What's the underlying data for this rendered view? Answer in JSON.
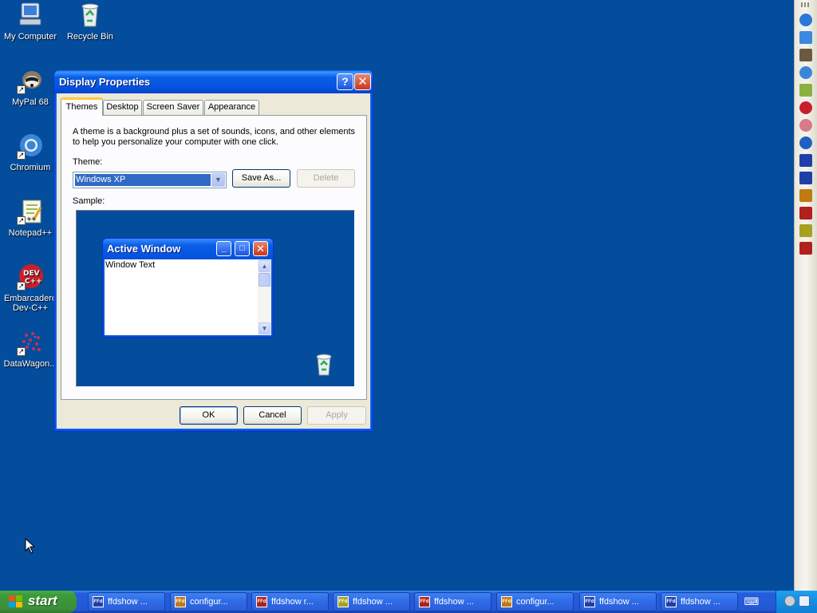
{
  "desktop": {
    "icons": [
      {
        "label": "My Computer",
        "icon": "computer-icon"
      },
      {
        "label": "Recycle Bin",
        "icon": "recycle-bin-icon"
      },
      {
        "label": "MyPal 68",
        "icon": "mypal-icon"
      },
      {
        "label": "Chromium",
        "icon": "chromium-icon"
      },
      {
        "label": "Notepad++",
        "icon": "notepadpp-icon"
      },
      {
        "label": "Embarcadero Dev-C++",
        "icon": "devcpp-icon"
      },
      {
        "label": "DataWagon...",
        "icon": "datawagon-icon"
      }
    ],
    "background_color": "#044C9C"
  },
  "window": {
    "title": "Display Properties",
    "help_glyph": "?",
    "close_glyph": "✕",
    "tabs": [
      "Themes",
      "Desktop",
      "Screen Saver",
      "Appearance"
    ],
    "active_tab": "Themes",
    "description": "A theme is a background plus a set of sounds, icons, and other elements to help you personalize your computer with one click.",
    "theme_label": "Theme:",
    "theme_value": "Windows XP",
    "save_as_label": "Save As...",
    "delete_label": "Delete",
    "sample_label": "Sample:",
    "sample": {
      "window_title": "Active Window",
      "window_text": "Window Text"
    },
    "ok_label": "OK",
    "cancel_label": "Cancel",
    "apply_label": "Apply"
  },
  "taskbar": {
    "start_label": "start",
    "tasks": [
      {
        "label": "ffdshow ...",
        "icon": "ffdshow-icon",
        "color": "#1e3fa8",
        "glyph": "FFd"
      },
      {
        "label": "configur...",
        "icon": "ffdshow-config-icon",
        "color": "#c07a10",
        "glyph": "FFd"
      },
      {
        "label": "ffdshow r...",
        "icon": "ffdshow-red-icon",
        "color": "#b0201c",
        "glyph": "FFd"
      },
      {
        "label": "ffdshow ...",
        "icon": "ffdshow-yellow-icon",
        "color": "#a8a020",
        "glyph": "FFd"
      },
      {
        "label": "ffdshow ...",
        "icon": "ffdshow-red-icon",
        "color": "#b0201c",
        "glyph": "FFd"
      },
      {
        "label": "configur...",
        "icon": "ffdshow-config-icon",
        "color": "#c07a10",
        "glyph": "FFd"
      },
      {
        "label": "ffdshow ...",
        "icon": "ffdshow-icon",
        "color": "#1e3fa8",
        "glyph": "FFd"
      },
      {
        "label": "ffdshow ...",
        "icon": "ffdshow-icon",
        "color": "#1e3fa8",
        "glyph": "FFd"
      }
    ]
  },
  "quick_launch": [
    {
      "icon": "ie-icon",
      "color": "#2c78d8"
    },
    {
      "icon": "ie-page-icon",
      "color": "#3c88e0"
    },
    {
      "icon": "mypal-icon",
      "color": "#6a5a40"
    },
    {
      "icon": "chromium-icon",
      "color": "#3b86d8"
    },
    {
      "icon": "notepadpp-icon",
      "color": "#8cb040"
    },
    {
      "icon": "devcpp-icon",
      "color": "#c8202a"
    },
    {
      "icon": "datawagon-icon",
      "color": "#d87a8a"
    },
    {
      "icon": "media-player-icon",
      "color": "#2060c0"
    },
    {
      "icon": "ffdshow-icon",
      "color": "#1e3fa8"
    },
    {
      "icon": "ffdshow-icon",
      "color": "#1e3fa8"
    },
    {
      "icon": "ffdshow-config-icon",
      "color": "#c07a10"
    },
    {
      "icon": "ffdshow-red-icon",
      "color": "#b0201c"
    },
    {
      "icon": "ffdshow-yellow-icon",
      "color": "#a8a020"
    },
    {
      "icon": "ffdshow-red-icon",
      "color": "#b0201c"
    }
  ]
}
